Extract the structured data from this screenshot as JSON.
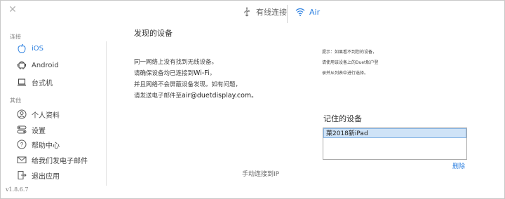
{
  "window": {
    "close_glyph": "✕"
  },
  "tabs": [
    {
      "label": "有线连接",
      "icon": "usb-icon",
      "active": false
    },
    {
      "label": "Air",
      "icon": "wifi-icon",
      "active": true
    }
  ],
  "sidebar": {
    "connect_section": "连接",
    "connect_items": [
      {
        "label": "iOS",
        "icon": "apple-icon",
        "active": true
      },
      {
        "label": "Android",
        "icon": "android-icon",
        "active": false
      },
      {
        "label": "台式机",
        "icon": "laptop-icon",
        "active": false
      }
    ],
    "other_section": "其他",
    "other_items": [
      {
        "label": "个人资料",
        "icon": "user-icon"
      },
      {
        "label": "设置",
        "icon": "toggle-icon"
      },
      {
        "label": "帮助中心",
        "icon": "help-icon"
      },
      {
        "label": "给我们发电子邮件",
        "icon": "mail-icon"
      },
      {
        "label": "退出应用",
        "icon": "exit-icon"
      }
    ],
    "version": "v1.8.6.7"
  },
  "main": {
    "title": "发现的设备",
    "instructions": {
      "line1": "同一网络上没有找到无线设备。",
      "line2_prefix": "请确保设备均已连接到",
      "line2_em": "Wi-Fi",
      "line2_suffix": "。",
      "line3": "并且网络不会屏蔽设备发现。如有问题，",
      "line4_prefix": "请发送电子邮件至",
      "line4_em": "air@duetdisplay.com",
      "line4_suffix": "。"
    },
    "manual_ip": "手动连接到IP"
  },
  "right": {
    "tips": [
      "提示：如果看不到您的设备，",
      "请使用该设备上的Duet账户登",
      "录并从列表中进行选择。"
    ],
    "remembered_title": "记住的设备",
    "devices": [
      "菜2018新iPad"
    ],
    "delete_label": "删除"
  },
  "colors": {
    "accent": "#2b7fe0",
    "selection_bg": "#cfe3f7"
  }
}
